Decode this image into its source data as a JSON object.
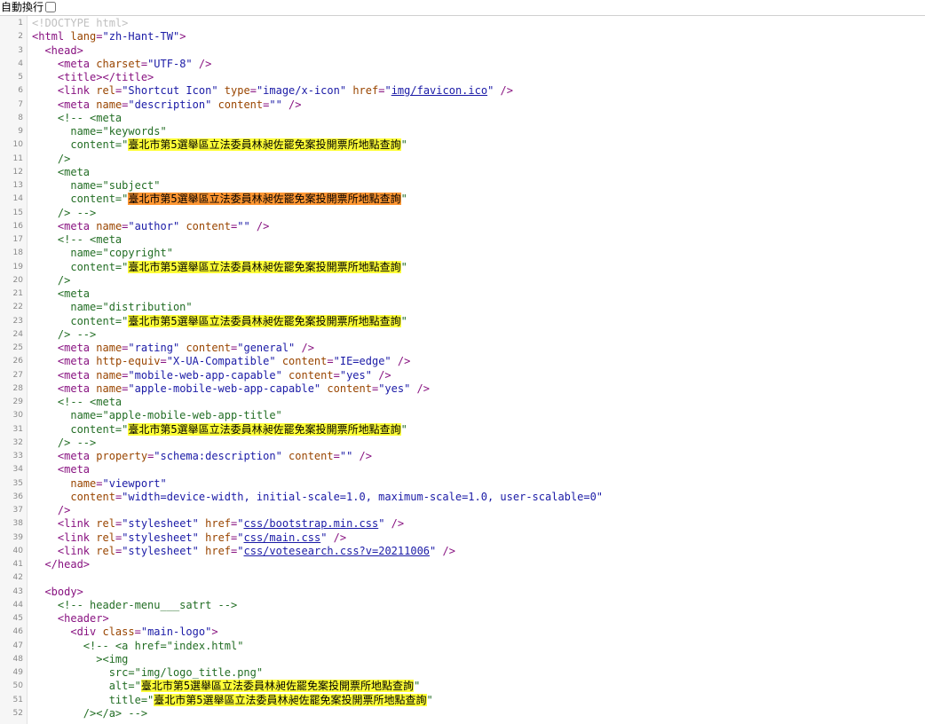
{
  "wrap_toggle": {
    "label": "自動換行",
    "checked": false
  },
  "colors": {
    "tag": "#881280",
    "attr": "#994500",
    "value": "#1a1aa6",
    "comment": "#236e25",
    "highlight": "#ffff38",
    "highlight_current": "#ff9632"
  },
  "source_lines": [
    {
      "n": "1",
      "ind": "",
      "seg": [
        [
          "dt",
          "<!DOCTYPE html>"
        ]
      ]
    },
    {
      "n": "2",
      "ind": "",
      "seg": [
        [
          "tag",
          "<html "
        ],
        [
          "attr",
          "lang"
        ],
        [
          "tag",
          "="
        ],
        [
          "val",
          "\"zh-Hant-TW\""
        ],
        [
          "tag",
          ">"
        ]
      ]
    },
    {
      "n": "3",
      "ind": "  ",
      "seg": [
        [
          "tag",
          "<head>"
        ]
      ]
    },
    {
      "n": "4",
      "ind": "    ",
      "seg": [
        [
          "tag",
          "<meta "
        ],
        [
          "attr",
          "charset"
        ],
        [
          "tag",
          "="
        ],
        [
          "val",
          "\"UTF-8\""
        ],
        [
          "tag",
          " />"
        ]
      ]
    },
    {
      "n": "5",
      "ind": "    ",
      "seg": [
        [
          "tag",
          "<title></title>"
        ]
      ]
    },
    {
      "n": "6",
      "ind": "    ",
      "seg": [
        [
          "tag",
          "<link "
        ],
        [
          "attr",
          "rel"
        ],
        [
          "tag",
          "="
        ],
        [
          "val",
          "\"Shortcut Icon\""
        ],
        [
          "tag",
          " "
        ],
        [
          "attr",
          "type"
        ],
        [
          "tag",
          "="
        ],
        [
          "val",
          "\"image/x-icon\""
        ],
        [
          "tag",
          " "
        ],
        [
          "attr",
          "href"
        ],
        [
          "tag",
          "="
        ],
        [
          "val",
          "\""
        ],
        [
          "lnk",
          "img/favicon.ico"
        ],
        [
          "val",
          "\""
        ],
        [
          "tag",
          " />"
        ]
      ]
    },
    {
      "n": "7",
      "ind": "    ",
      "seg": [
        [
          "tag",
          "<meta "
        ],
        [
          "attr",
          "name"
        ],
        [
          "tag",
          "="
        ],
        [
          "val",
          "\"description\""
        ],
        [
          "tag",
          " "
        ],
        [
          "attr",
          "content"
        ],
        [
          "tag",
          "="
        ],
        [
          "val",
          "\"\""
        ],
        [
          "tag",
          " />"
        ]
      ]
    },
    {
      "n": "8",
      "ind": "    ",
      "seg": [
        [
          "cmt",
          "<!-- <meta"
        ]
      ]
    },
    {
      "n": "9",
      "ind": "      ",
      "seg": [
        [
          "cmt",
          "name=\"keywords\""
        ]
      ]
    },
    {
      "n": "10",
      "ind": "      ",
      "seg": [
        [
          "cmt",
          "content=\""
        ],
        [
          "hl",
          "臺北市第5選舉區立法委員林昶佐罷免案投開票所地點查詢"
        ],
        [
          "cmt",
          "\""
        ]
      ]
    },
    {
      "n": "11",
      "ind": "    ",
      "seg": [
        [
          "cmt",
          "/>"
        ]
      ]
    },
    {
      "n": "12",
      "ind": "    ",
      "seg": [
        [
          "cmt",
          "<meta"
        ]
      ]
    },
    {
      "n": "13",
      "ind": "      ",
      "seg": [
        [
          "cmt",
          "name=\"subject\""
        ]
      ]
    },
    {
      "n": "14",
      "ind": "      ",
      "seg": [
        [
          "cmt",
          "content=\""
        ],
        [
          "hl-o",
          "臺北市第5選舉區立法委員林昶佐罷免案投開票所地點查詢"
        ],
        [
          "cmt",
          "\""
        ]
      ]
    },
    {
      "n": "15",
      "ind": "    ",
      "seg": [
        [
          "cmt",
          "/> -->"
        ]
      ]
    },
    {
      "n": "16",
      "ind": "    ",
      "seg": [
        [
          "tag",
          "<meta "
        ],
        [
          "attr",
          "name"
        ],
        [
          "tag",
          "="
        ],
        [
          "val",
          "\"author\""
        ],
        [
          "tag",
          " "
        ],
        [
          "attr",
          "content"
        ],
        [
          "tag",
          "="
        ],
        [
          "val",
          "\"\""
        ],
        [
          "tag",
          " />"
        ]
      ]
    },
    {
      "n": "17",
      "ind": "    ",
      "seg": [
        [
          "cmt",
          "<!-- <meta"
        ]
      ]
    },
    {
      "n": "18",
      "ind": "      ",
      "seg": [
        [
          "cmt",
          "name=\"copyright\""
        ]
      ]
    },
    {
      "n": "19",
      "ind": "      ",
      "seg": [
        [
          "cmt",
          "content=\""
        ],
        [
          "hl",
          "臺北市第5選舉區立法委員林昶佐罷免案投開票所地點查詢"
        ],
        [
          "cmt",
          "\""
        ]
      ]
    },
    {
      "n": "20",
      "ind": "    ",
      "seg": [
        [
          "cmt",
          "/>"
        ]
      ]
    },
    {
      "n": "21",
      "ind": "    ",
      "seg": [
        [
          "cmt",
          "<meta"
        ]
      ]
    },
    {
      "n": "22",
      "ind": "      ",
      "seg": [
        [
          "cmt",
          "name=\"distribution\""
        ]
      ]
    },
    {
      "n": "23",
      "ind": "      ",
      "seg": [
        [
          "cmt",
          "content=\""
        ],
        [
          "hl",
          "臺北市第5選舉區立法委員林昶佐罷免案投開票所地點查詢"
        ],
        [
          "cmt",
          "\""
        ]
      ]
    },
    {
      "n": "24",
      "ind": "    ",
      "seg": [
        [
          "cmt",
          "/> -->"
        ]
      ]
    },
    {
      "n": "25",
      "ind": "    ",
      "seg": [
        [
          "tag",
          "<meta "
        ],
        [
          "attr",
          "name"
        ],
        [
          "tag",
          "="
        ],
        [
          "val",
          "\"rating\""
        ],
        [
          "tag",
          " "
        ],
        [
          "attr",
          "content"
        ],
        [
          "tag",
          "="
        ],
        [
          "val",
          "\"general\""
        ],
        [
          "tag",
          " />"
        ]
      ]
    },
    {
      "n": "26",
      "ind": "    ",
      "seg": [
        [
          "tag",
          "<meta "
        ],
        [
          "attr",
          "http-equiv"
        ],
        [
          "tag",
          "="
        ],
        [
          "val",
          "\"X-UA-Compatible\""
        ],
        [
          "tag",
          " "
        ],
        [
          "attr",
          "content"
        ],
        [
          "tag",
          "="
        ],
        [
          "val",
          "\"IE=edge\""
        ],
        [
          "tag",
          " />"
        ]
      ]
    },
    {
      "n": "27",
      "ind": "    ",
      "seg": [
        [
          "tag",
          "<meta "
        ],
        [
          "attr",
          "name"
        ],
        [
          "tag",
          "="
        ],
        [
          "val",
          "\"mobile-web-app-capable\""
        ],
        [
          "tag",
          " "
        ],
        [
          "attr",
          "content"
        ],
        [
          "tag",
          "="
        ],
        [
          "val",
          "\"yes\""
        ],
        [
          "tag",
          " />"
        ]
      ]
    },
    {
      "n": "28",
      "ind": "    ",
      "seg": [
        [
          "tag",
          "<meta "
        ],
        [
          "attr",
          "name"
        ],
        [
          "tag",
          "="
        ],
        [
          "val",
          "\"apple-mobile-web-app-capable\""
        ],
        [
          "tag",
          " "
        ],
        [
          "attr",
          "content"
        ],
        [
          "tag",
          "="
        ],
        [
          "val",
          "\"yes\""
        ],
        [
          "tag",
          " />"
        ]
      ]
    },
    {
      "n": "29",
      "ind": "    ",
      "seg": [
        [
          "cmt",
          "<!-- <meta"
        ]
      ]
    },
    {
      "n": "30",
      "ind": "      ",
      "seg": [
        [
          "cmt",
          "name=\"apple-mobile-web-app-title\""
        ]
      ]
    },
    {
      "n": "31",
      "ind": "      ",
      "seg": [
        [
          "cmt",
          "content=\""
        ],
        [
          "hl",
          "臺北市第5選舉區立法委員林昶佐罷免案投開票所地點查詢"
        ],
        [
          "cmt",
          "\""
        ]
      ]
    },
    {
      "n": "32",
      "ind": "    ",
      "seg": [
        [
          "cmt",
          "/> -->"
        ]
      ]
    },
    {
      "n": "33",
      "ind": "    ",
      "seg": [
        [
          "tag",
          "<meta "
        ],
        [
          "attr",
          "property"
        ],
        [
          "tag",
          "="
        ],
        [
          "val",
          "\"schema:description\""
        ],
        [
          "tag",
          " "
        ],
        [
          "attr",
          "content"
        ],
        [
          "tag",
          "="
        ],
        [
          "val",
          "\"\""
        ],
        [
          "tag",
          " />"
        ]
      ]
    },
    {
      "n": "34",
      "ind": "    ",
      "seg": [
        [
          "tag",
          "<meta"
        ]
      ]
    },
    {
      "n": "35",
      "ind": "      ",
      "seg": [
        [
          "attr",
          "name"
        ],
        [
          "tag",
          "="
        ],
        [
          "val",
          "\"viewport\""
        ]
      ]
    },
    {
      "n": "36",
      "ind": "      ",
      "seg": [
        [
          "attr",
          "content"
        ],
        [
          "tag",
          "="
        ],
        [
          "val",
          "\"width=device-width, initial-scale=1.0, maximum-scale=1.0, user-scalable=0\""
        ]
      ]
    },
    {
      "n": "37",
      "ind": "    ",
      "seg": [
        [
          "tag",
          "/>"
        ]
      ]
    },
    {
      "n": "38",
      "ind": "    ",
      "seg": [
        [
          "tag",
          "<link "
        ],
        [
          "attr",
          "rel"
        ],
        [
          "tag",
          "="
        ],
        [
          "val",
          "\"stylesheet\""
        ],
        [
          "tag",
          " "
        ],
        [
          "attr",
          "href"
        ],
        [
          "tag",
          "="
        ],
        [
          "val",
          "\""
        ],
        [
          "lnk",
          "css/bootstrap.min.css"
        ],
        [
          "val",
          "\""
        ],
        [
          "tag",
          " />"
        ]
      ]
    },
    {
      "n": "39",
      "ind": "    ",
      "seg": [
        [
          "tag",
          "<link "
        ],
        [
          "attr",
          "rel"
        ],
        [
          "tag",
          "="
        ],
        [
          "val",
          "\"stylesheet\""
        ],
        [
          "tag",
          " "
        ],
        [
          "attr",
          "href"
        ],
        [
          "tag",
          "="
        ],
        [
          "val",
          "\""
        ],
        [
          "lnk",
          "css/main.css"
        ],
        [
          "val",
          "\""
        ],
        [
          "tag",
          " />"
        ]
      ]
    },
    {
      "n": "40",
      "ind": "    ",
      "seg": [
        [
          "tag",
          "<link "
        ],
        [
          "attr",
          "rel"
        ],
        [
          "tag",
          "="
        ],
        [
          "val",
          "\"stylesheet\""
        ],
        [
          "tag",
          " "
        ],
        [
          "attr",
          "href"
        ],
        [
          "tag",
          "="
        ],
        [
          "val",
          "\""
        ],
        [
          "lnk",
          "css/votesearch.css?v=20211006"
        ],
        [
          "val",
          "\""
        ],
        [
          "tag",
          " />"
        ]
      ]
    },
    {
      "n": "41",
      "ind": "  ",
      "seg": [
        [
          "tag",
          "</head>"
        ]
      ]
    },
    {
      "n": "42",
      "ind": "",
      "seg": []
    },
    {
      "n": "43",
      "ind": "  ",
      "seg": [
        [
          "tag",
          "<body>"
        ]
      ]
    },
    {
      "n": "44",
      "ind": "    ",
      "seg": [
        [
          "cmt",
          "<!-- header-menu___satrt -->"
        ]
      ]
    },
    {
      "n": "45",
      "ind": "    ",
      "seg": [
        [
          "tag",
          "<header>"
        ]
      ]
    },
    {
      "n": "46",
      "ind": "      ",
      "seg": [
        [
          "tag",
          "<div "
        ],
        [
          "attr",
          "class"
        ],
        [
          "tag",
          "="
        ],
        [
          "val",
          "\"main-logo\""
        ],
        [
          "tag",
          ">"
        ]
      ]
    },
    {
      "n": "47",
      "ind": "        ",
      "seg": [
        [
          "cmt",
          "<!-- <a href=\"index.html\""
        ]
      ]
    },
    {
      "n": "48",
      "ind": "          ",
      "seg": [
        [
          "cmt",
          "><img"
        ]
      ]
    },
    {
      "n": "49",
      "ind": "            ",
      "seg": [
        [
          "cmt",
          "src=\"img/logo_title.png\""
        ]
      ]
    },
    {
      "n": "50",
      "ind": "            ",
      "seg": [
        [
          "cmt",
          "alt=\""
        ],
        [
          "hl",
          "臺北市第5選舉區立法委員林昶佐罷免案投開票所地點查詢"
        ],
        [
          "cmt",
          "\""
        ]
      ]
    },
    {
      "n": "51",
      "ind": "            ",
      "seg": [
        [
          "cmt",
          "title=\""
        ],
        [
          "hl",
          "臺北市第5選舉區立法委員林昶佐罷免案投開票所地點查詢"
        ],
        [
          "cmt",
          "\""
        ]
      ]
    },
    {
      "n": "52",
      "ind": "        ",
      "seg": [
        [
          "cmt",
          "/></a> -->"
        ]
      ]
    }
  ]
}
